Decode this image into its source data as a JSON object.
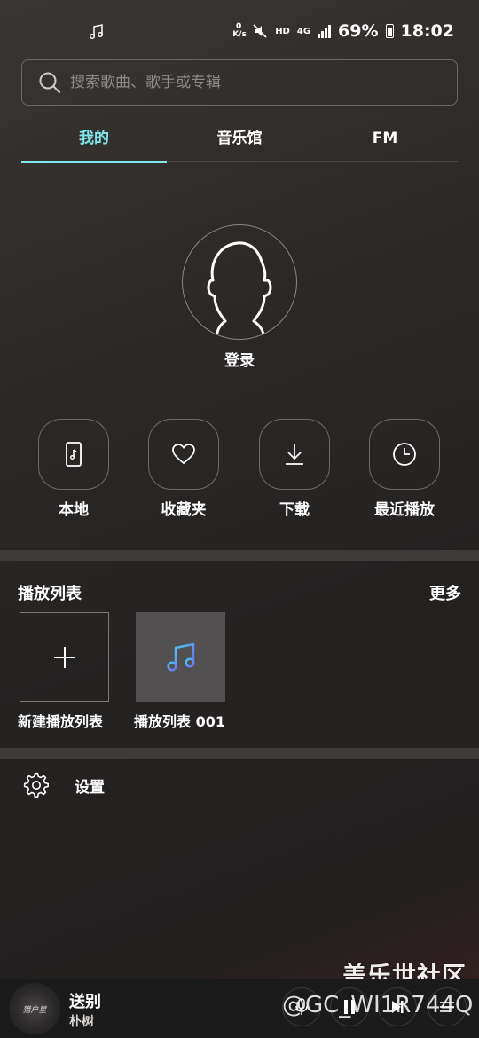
{
  "status_bar": {
    "network_speed_top": "0",
    "network_speed_unit": "K/s",
    "hd": "HD",
    "network": "4G",
    "battery": "69%",
    "time": "18:02",
    "icons": [
      "music-note-icon",
      "mute-icon",
      "signal-icon",
      "battery-icon"
    ]
  },
  "search": {
    "placeholder": "搜索歌曲、歌手或专辑"
  },
  "tabs": [
    {
      "label": "我的",
      "active": true
    },
    {
      "label": "音乐馆",
      "active": false
    },
    {
      "label": "FM",
      "active": false
    }
  ],
  "accent_color": "#7fe6ec",
  "profile": {
    "login_label": "登录"
  },
  "quick_actions": [
    {
      "label": "本地",
      "icon": "phone-music-icon"
    },
    {
      "label": "收藏夹",
      "icon": "heart-icon"
    },
    {
      "label": "下载",
      "icon": "download-icon"
    },
    {
      "label": "最近播放",
      "icon": "clock-icon"
    }
  ],
  "playlists": {
    "title": "播放列表",
    "more_label": "更多",
    "items": [
      {
        "label": "新建播放列表",
        "icon": "plus-icon"
      },
      {
        "label": "播放列表 001",
        "icon": "music-notes-icon"
      }
    ]
  },
  "settings": {
    "label": "设置",
    "icon": "gear-icon"
  },
  "watermark": {
    "title": "盖乐世社区",
    "id": "@GC_WI1R744Q"
  },
  "player": {
    "song": "送别",
    "artist": "朴树",
    "album_text": "猎户星"
  }
}
